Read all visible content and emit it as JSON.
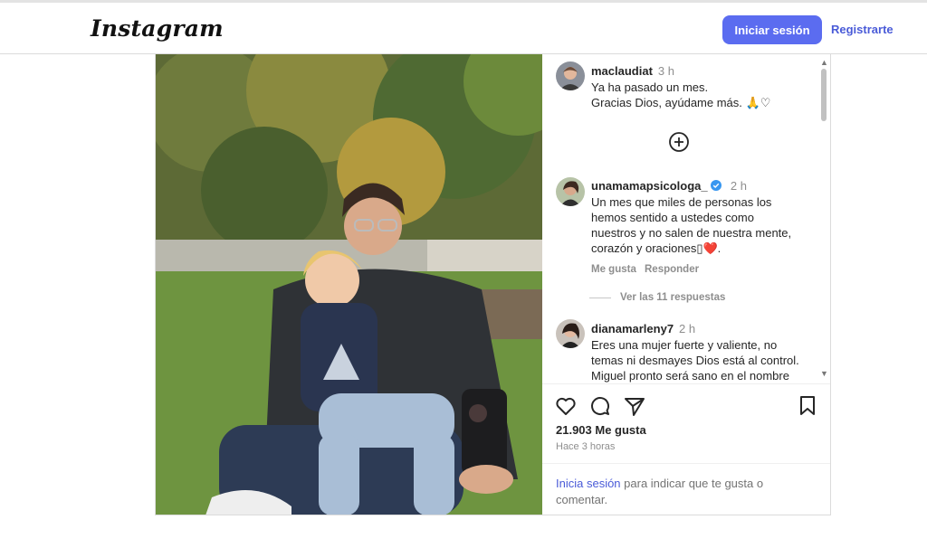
{
  "header": {
    "logo": "Instagram",
    "login_label": "Iniciar sesión",
    "register_label": "Registrarte"
  },
  "comments": [
    {
      "user": "maclaudiat",
      "time": "3 h",
      "lines": [
        "Ya ha pasado un mes.",
        "Gracias Dios, ayúdame más. 🙏♡"
      ]
    },
    {
      "user": "unamamapsicologa_",
      "time": "2 h",
      "verified": true,
      "lines": [
        "Un mes que miles de personas los",
        "hemos sentido a ustedes como",
        "nuestros y no salen de nuestra mente,",
        "corazón y oraciones▯❤️."
      ],
      "like_label": "Me gusta",
      "reply_label": "Responder",
      "view_replies": "Ver las 11 respuestas"
    },
    {
      "user": "dianamarleny7",
      "time": "2 h",
      "lines": [
        "Eres una mujer fuerte y valiente, no",
        "temas ni desmayes Dios está al control.",
        "Miguel pronto será sano en el nombre"
      ]
    }
  ],
  "post": {
    "likes": "21.903 Me gusta",
    "ago": "Hace 3 horas"
  },
  "footer": {
    "link": "Inicia sesión",
    "text": " para indicar que te gusta o comentar."
  }
}
